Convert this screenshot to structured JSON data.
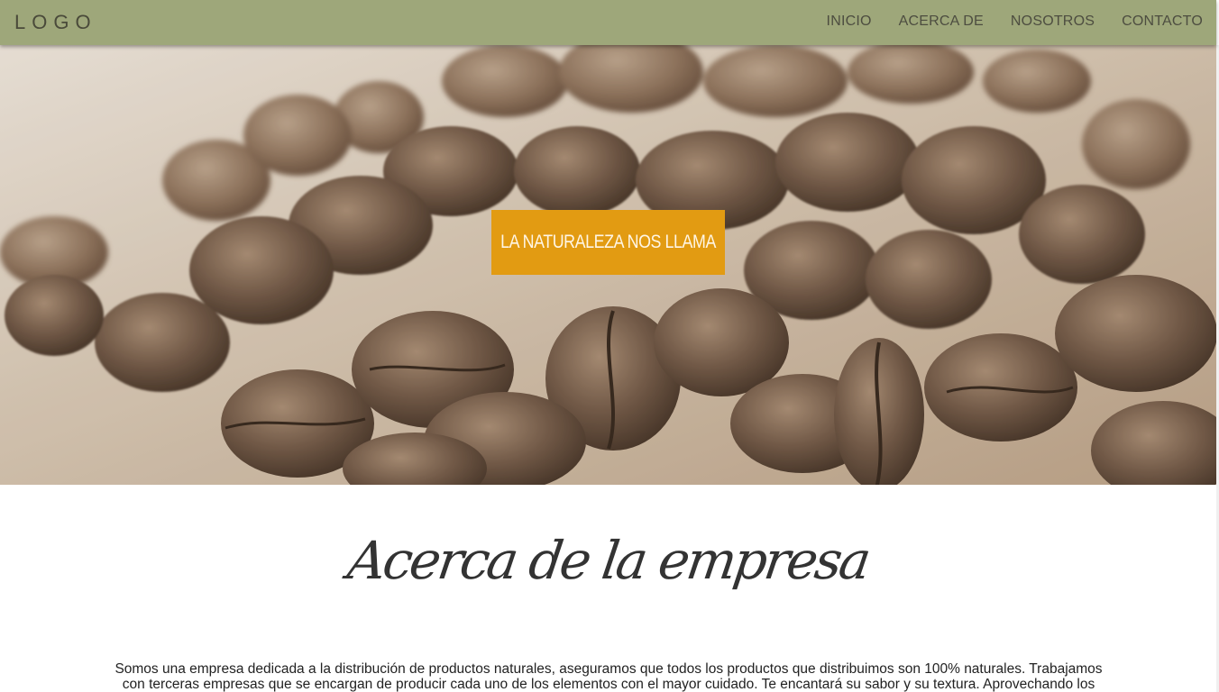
{
  "header": {
    "logo": "LOGO",
    "nav": [
      {
        "label": "INICIO"
      },
      {
        "label": "ACERCA DE"
      },
      {
        "label": "NOSOTROS"
      },
      {
        "label": "CONTACTO"
      }
    ],
    "background_color": "#9ea77a"
  },
  "hero": {
    "banner_text": "LA NATURALEZA NOS LLAMA",
    "banner_color": "#e29b12",
    "image_subject": "coffee beans"
  },
  "about": {
    "title": "Acerca de la empresa",
    "text_line_1": "Somos una empresa dedicada a la distribución de productos naturales, aseguramos que todos los productos que distribuimos son 100% naturales. Trabajamos",
    "text_line_2": "con terceras empresas que se encargan de producir cada uno de los elementos con el mayor cuidado. Te encantará su sabor y su textura. Aprovechando los"
  }
}
